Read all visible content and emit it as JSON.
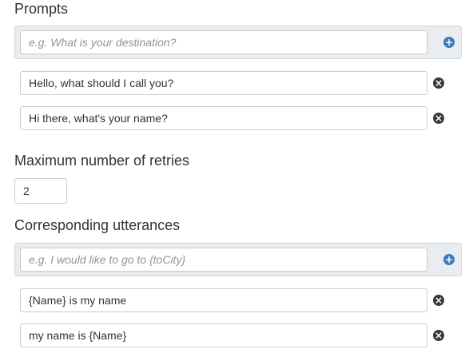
{
  "prompts": {
    "heading": "Prompts",
    "new_placeholder": "e.g. What is your destination?",
    "add_icon": "plus-circle-icon",
    "items": [
      {
        "value": "Hello, what should I call you?",
        "remove_icon": "times-circle-icon"
      },
      {
        "value": "Hi there, what's your name?",
        "remove_icon": "times-circle-icon"
      }
    ]
  },
  "retries": {
    "heading": "Maximum number of retries",
    "value": "2"
  },
  "utterances": {
    "heading": "Corresponding utterances",
    "new_placeholder": "e.g. I would like to go to {toCity}",
    "add_icon": "plus-circle-icon",
    "items": [
      {
        "value": "{Name} is my name",
        "remove_icon": "times-circle-icon"
      },
      {
        "value": "my name is {Name}",
        "remove_icon": "times-circle-icon"
      }
    ]
  },
  "colors": {
    "add_icon": "#3d7dbe",
    "remove_icon": "#3a3a3a",
    "new_box_background": "#eaedf0"
  },
  "glyphs": {
    "plus": "+",
    "times": "×"
  }
}
